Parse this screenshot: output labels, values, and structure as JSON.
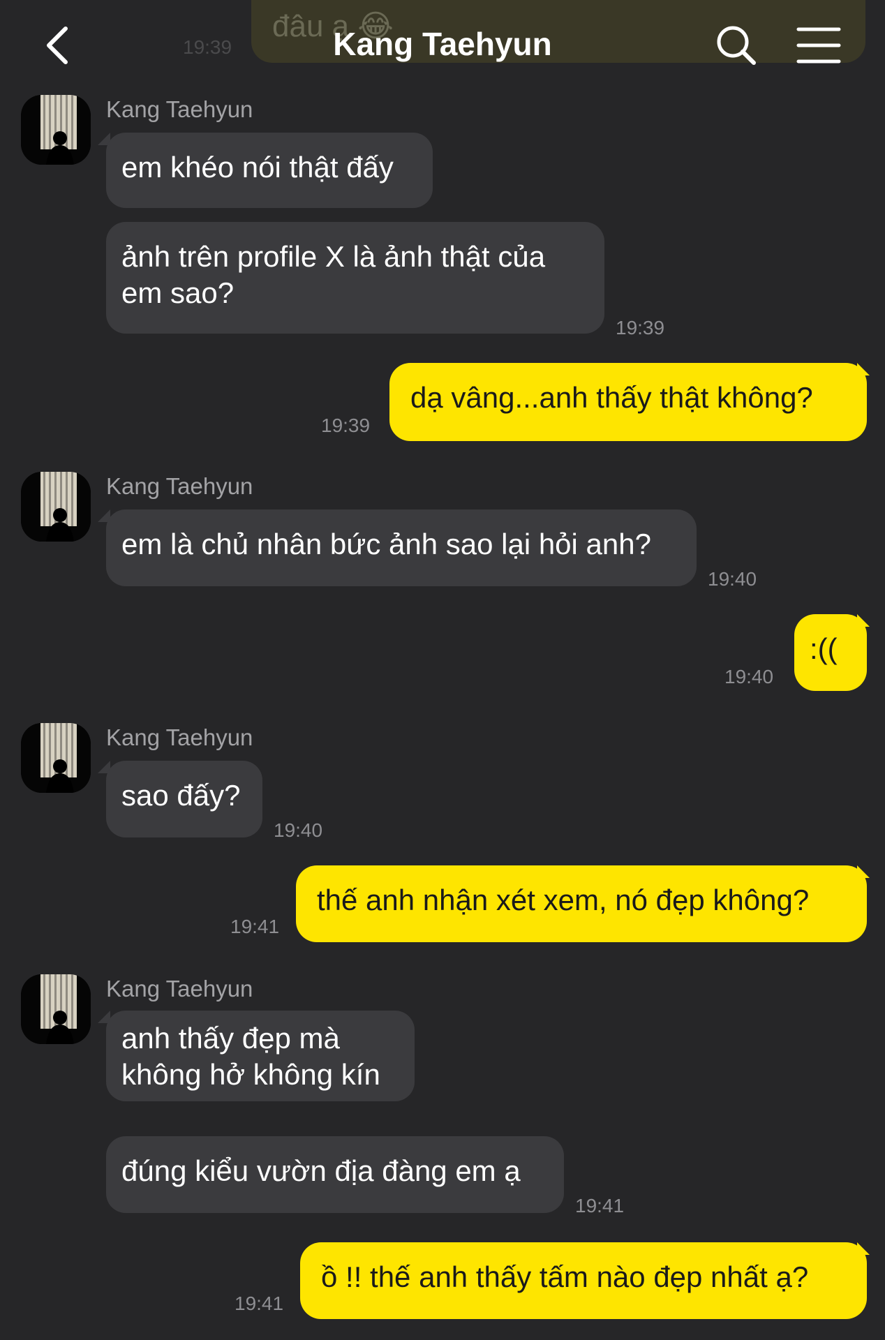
{
  "header": {
    "title": "Kang Taehyun",
    "back_icon": "chevron-left-icon",
    "search_icon": "search-icon",
    "menu_icon": "menu-icon"
  },
  "previous_message": {
    "text": "đâu ạ 😂",
    "time": "19:39"
  },
  "contact": {
    "name": "Kang Taehyun"
  },
  "messages": [
    {
      "side": "in",
      "text": "em khéo nói thật đấy"
    },
    {
      "side": "in",
      "text": "ảnh trên profile X là ảnh thật của\nem sao?",
      "time": "19:39"
    },
    {
      "side": "out",
      "text": "dạ vâng...anh thấy thật không?",
      "time": "19:39"
    },
    {
      "side": "in",
      "text": "em là chủ nhân bức ảnh sao lại hỏi anh?",
      "time": "19:40"
    },
    {
      "side": "out",
      "text": ":((",
      "time": "19:40"
    },
    {
      "side": "in",
      "text": "sao đấy?",
      "time": "19:40"
    },
    {
      "side": "out",
      "text": "thế anh nhận xét xem, nó đẹp không?",
      "time": "19:41"
    },
    {
      "side": "in",
      "text": "anh thấy đẹp mà\nkhông hở không kín"
    },
    {
      "side": "in",
      "text": "đúng kiểu vườn địa đàng em ạ",
      "time": "19:41"
    },
    {
      "side": "out",
      "text": "ồ !! thế anh thấy tấm nào đẹp nhất ạ?",
      "time": "19:41"
    }
  ],
  "colors": {
    "background": "#262628",
    "incoming_bubble": "#3b3b3e",
    "outgoing_bubble": "#fee500",
    "timestamp": "#8e8e92"
  }
}
